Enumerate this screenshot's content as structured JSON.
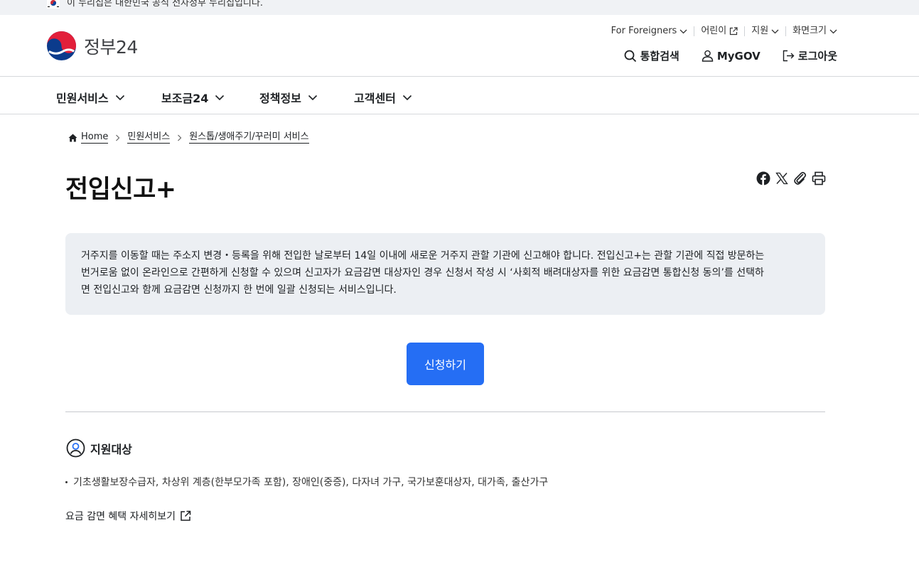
{
  "banner": {
    "text": "이 누리집은 대한민국 공식 전자정부 누리집입니다."
  },
  "logo": {
    "text": "정부24"
  },
  "util_links": [
    {
      "label": "For Foreigners",
      "icon": "chevron-down-icon"
    },
    {
      "label": "어린이",
      "icon": "external-link-icon"
    },
    {
      "label": "지원",
      "icon": "chevron-down-icon"
    },
    {
      "label": "화면크기",
      "icon": "chevron-down-icon"
    }
  ],
  "main_actions": [
    {
      "label": "통합검색",
      "icon": "search-icon"
    },
    {
      "label": "MyGOV",
      "icon": "user-icon"
    },
    {
      "label": "로그아웃",
      "icon": "logout-icon"
    }
  ],
  "gnb": [
    {
      "label": "민원서비스"
    },
    {
      "label": "보조금24"
    },
    {
      "label": "정책정보"
    },
    {
      "label": "고객센터"
    }
  ],
  "breadcrumb": [
    {
      "label": "Home"
    },
    {
      "label": "민원서비스"
    },
    {
      "label": "원스톱/생애주기/꾸러미 서비스"
    }
  ],
  "page_title": "전입신고+",
  "share_icons": [
    "facebook-icon",
    "x-icon",
    "link-icon",
    "print-icon"
  ],
  "info_box": {
    "lines": [
      "거주지를 이동할 때는 주소지 변경・등록을 위해 전입한 날로부터 14일 이내에 새로운 거주지 관할 기관에 신고해야 합니다. 전입신고+는 관할 기관에 직접 방문하는",
      "번거로움 없이 온라인으로 간편하게 신청할 수 있으며 신고자가 요금감면 대상자인 경우 신청서 작성 시 ‘사회적 배려대상자를 위한 요금감면 통합신청 동의’를 선택하",
      "면 전입신고와 함께 요금감면 신청까지 한 번에 일괄 신청되는 서비스입니다."
    ]
  },
  "apply_button": "신청하기",
  "section": {
    "title": "지원대상",
    "items": [
      "기초생활보장수급자, 차상위 계층(한부모가족 포함), 장애인(중증), 다자녀 가구, 국가보훈대상자, 대가족, 출산가구"
    ]
  },
  "detail_link": "요금 감면 혜택 자세히보기",
  "colors": {
    "primary": "#256ef4",
    "info_bg": "#eceff3",
    "banner_bg": "#f0f2f5"
  }
}
